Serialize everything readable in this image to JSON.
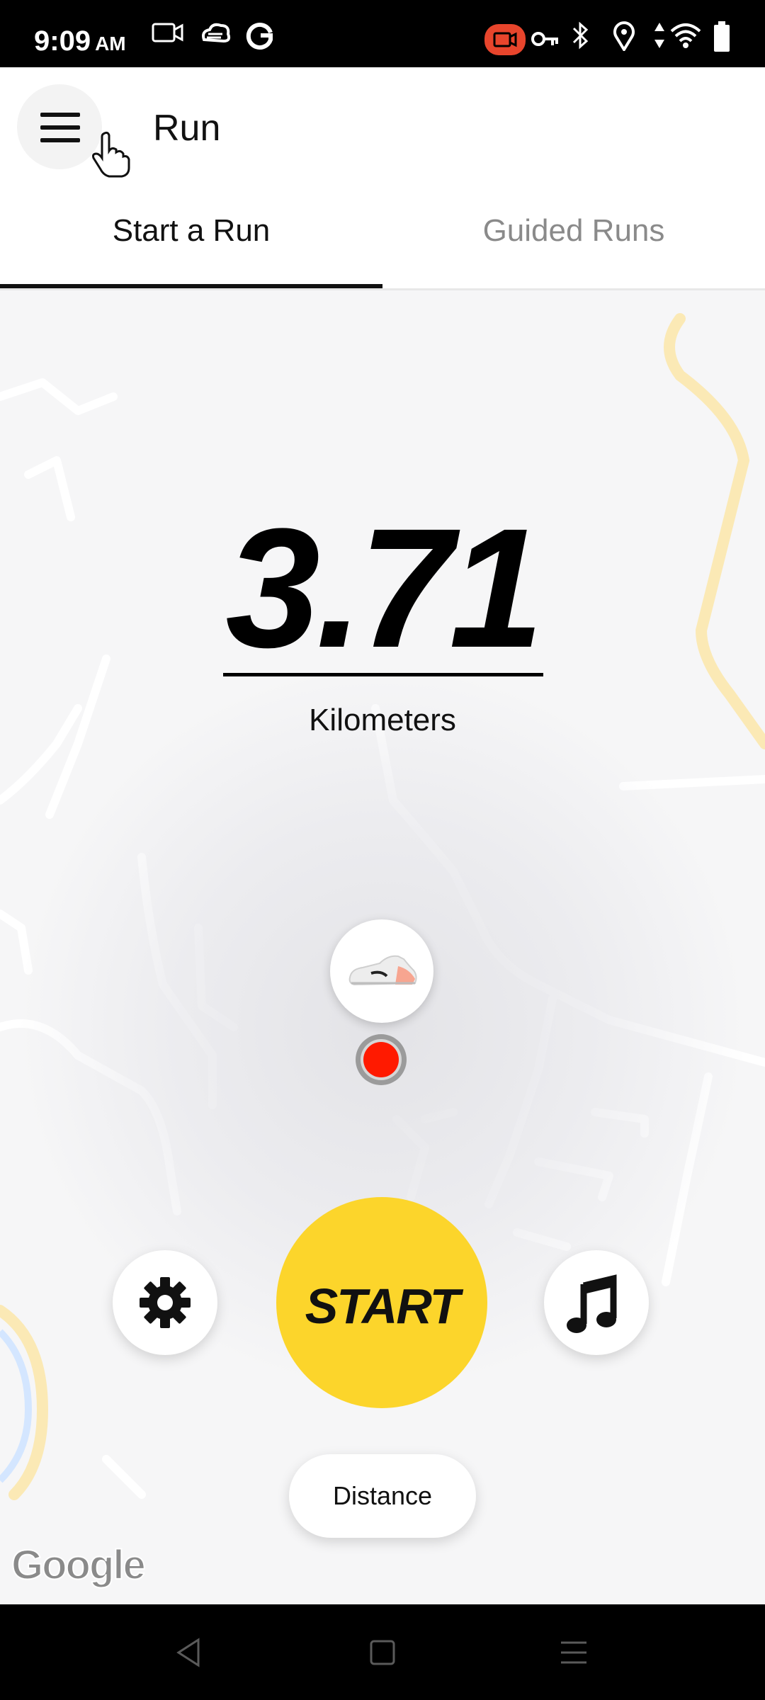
{
  "status_bar": {
    "time": "9:09",
    "ampm": "AM",
    "icons": [
      "video-icon",
      "cloud-icon",
      "google-icon",
      "screen-record-icon",
      "vpn-key-icon",
      "bluetooth-icon",
      "location-icon",
      "data-arrows-icon",
      "wifi-icon",
      "battery-icon"
    ]
  },
  "app_bar": {
    "menu_icon": "hamburger-menu-icon",
    "title": "Run"
  },
  "tabs": [
    {
      "label": "Start a Run",
      "selected": true
    },
    {
      "label": "Guided Runs",
      "selected": false
    }
  ],
  "run_goal": {
    "value": "3.71",
    "unit": "Kilometers"
  },
  "controls": {
    "settings_icon": "gear-icon",
    "start_label": "START",
    "music_icon": "music-note-icon",
    "goal_type_label": "Distance"
  },
  "map": {
    "attribution": "Google"
  },
  "colors": {
    "start_button": "#fcd52b",
    "location_dot": "#ff1a00",
    "recording_badge": "#e8452c"
  },
  "nav_bar": {
    "icons": [
      "back-icon",
      "home-icon",
      "recents-icon"
    ]
  }
}
